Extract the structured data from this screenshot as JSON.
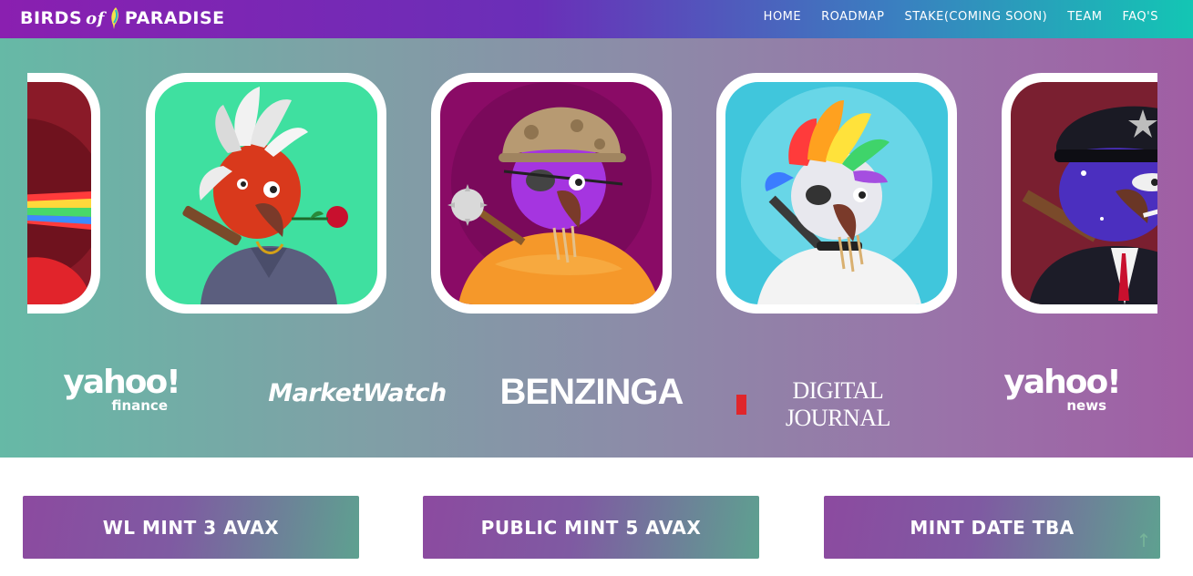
{
  "brand": {
    "logo_text_left": "BIRDS",
    "logo_text_mid": "of",
    "logo_text_right": "PARADISE"
  },
  "nav": {
    "items": [
      {
        "label": "HOME"
      },
      {
        "label": "ROADMAP"
      },
      {
        "label": "STAKE(COMING SOON)"
      },
      {
        "label": "TEAM"
      },
      {
        "label": "FAQ'S"
      }
    ]
  },
  "carousel": {
    "cards": [
      {
        "name": "Rainbow laser bird",
        "bg": "#8a1a28"
      },
      {
        "name": "Red feather bird with rose",
        "bg": "#3fe0a0"
      },
      {
        "name": "Purple soldier bird with mace",
        "bg": "#8a0b66"
      },
      {
        "name": "Rainbow crest pirate bird",
        "bg": "#40c6dc"
      },
      {
        "name": "Police cap galaxy bird",
        "bg": "#7a1f30"
      }
    ]
  },
  "press": {
    "yahoo_finance": {
      "word": "yahoo!",
      "sub": "finance"
    },
    "marketwatch": "MarketWatch",
    "benzinga": "BENZINGA",
    "digital_journal": "DIGITAL JOURNAL",
    "yahoo_news": {
      "word": "yahoo!",
      "sub": "news"
    }
  },
  "mint": {
    "wl": "WL MINT 3 AVAX",
    "public": "PUBLIC MINT 5 AVAX",
    "date": "MINT DATE TBA"
  },
  "scroll_top_icon": "↑",
  "colors": {
    "nav_start": "#8a1fb0",
    "nav_end": "#13c6b4",
    "hero_start": "#66b9a6",
    "hero_end": "#a05ea4",
    "button_start": "#8c4aa0",
    "button_end": "#5ea190"
  }
}
